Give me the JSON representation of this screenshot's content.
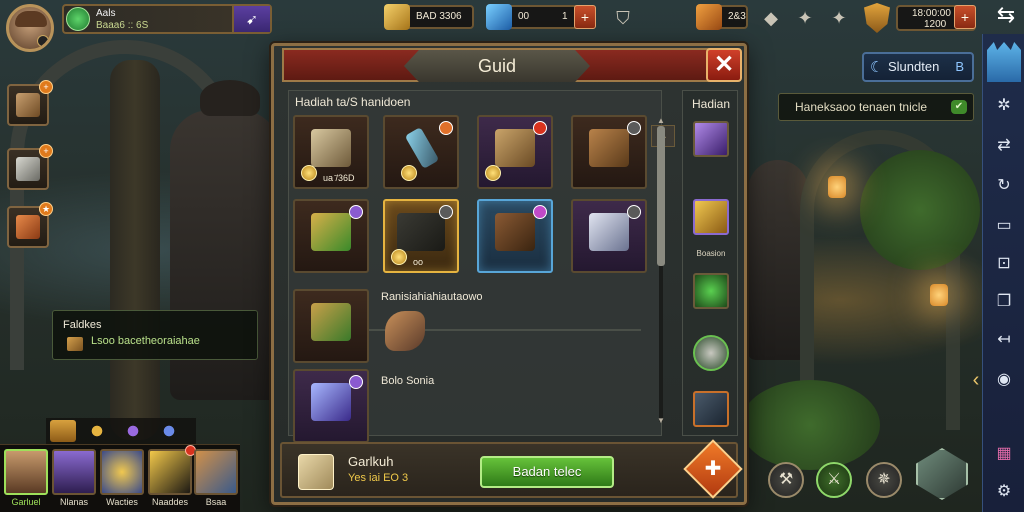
{
  "player": {
    "name": "Aals",
    "subtitle": "Baaa6 :: 6S"
  },
  "resources": {
    "gold": "BAD 3306",
    "gems": "00",
    "gems_count": "1",
    "token": "2&3",
    "timer_line1": "18:00:00",
    "timer_line2": "1200"
  },
  "top_icons": [
    "gauntlet-icon",
    "star-icon",
    "star-icon"
  ],
  "mission_button": {
    "label": "Slundten",
    "count": "B"
  },
  "notice": {
    "text": "Haneksaoo tenaen tnicle"
  },
  "tooltip": {
    "title": "Faldkes",
    "text": "Lsoo bacetheoraiahae"
  },
  "hero_bar": {
    "heroes": [
      {
        "name": "Garluel"
      },
      {
        "name": "Nlanas"
      },
      {
        "name": "Wacties"
      },
      {
        "name": "Naaddes"
      },
      {
        "name": "Bsaa"
      }
    ]
  },
  "dialog": {
    "title": "Guid",
    "close_label": "✕",
    "panel_heading": "Hadiah ta/S hanidoen",
    "slot_qty_1": "ua ̄/36D",
    "slot_qty_2": "oo",
    "section_a": "Ranisiahiahiautaowo",
    "section_b": "Bolo Sonia",
    "side_heading": "Hadian",
    "side_label": "Boasion",
    "footer": {
      "title": "Garlkuh",
      "subtitle": "Yes iai EO 3",
      "button_label": "Badan telec"
    }
  },
  "colors": {
    "dialog_frame": "#8c6e44",
    "header_red": "#8a2a20",
    "confirm_green": "#66c23a",
    "rail_blue": "#1f2c4a"
  }
}
